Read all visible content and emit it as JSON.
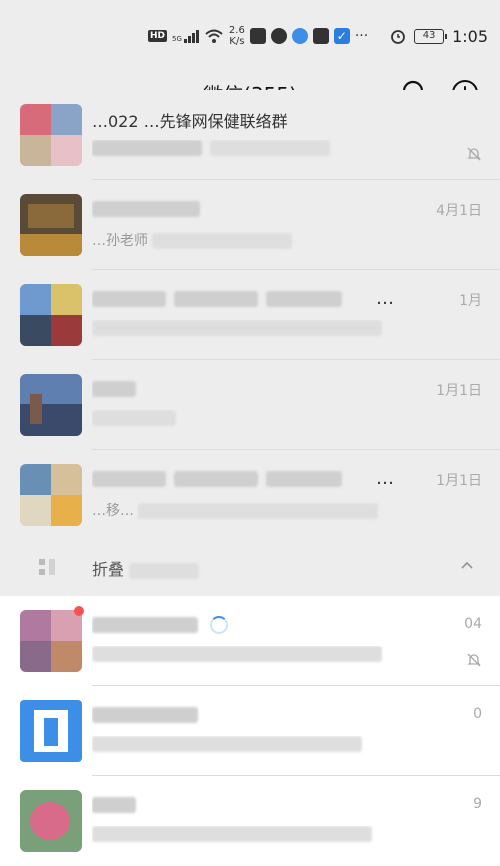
{
  "status_bar": {
    "hd": "HD",
    "network": "5G",
    "speed_value": "2.6",
    "speed_unit": "K/s",
    "more": "···",
    "battery": "43",
    "time": "1:05"
  },
  "header": {
    "title": "微信(355)",
    "search_icon": "search-icon",
    "add_icon": "plus-circle-icon"
  },
  "chats_top": [
    {
      "name_hint": "…022 …先锋网保健联络群",
      "preview_hint": "…通…",
      "time": "",
      "muted": true
    },
    {
      "name_hint": "",
      "preview_hint": "…孙老师",
      "time": "4月1日"
    },
    {
      "name_hint": "",
      "preview_hint": "…",
      "time": "1月",
      "dots": "…"
    },
    {
      "name_hint": "",
      "preview_hint": "",
      "time": "1月1日"
    },
    {
      "name_hint": "",
      "preview_hint": "…移…",
      "time": "1月1日",
      "dots": "…"
    }
  ],
  "folded_group": {
    "label": "折叠",
    "chevron": "chevron-up-icon"
  },
  "chats_bottom": [
    {
      "time": "04",
      "muted": true,
      "badge": true
    },
    {
      "time": "0"
    },
    {
      "time": "9"
    }
  ]
}
